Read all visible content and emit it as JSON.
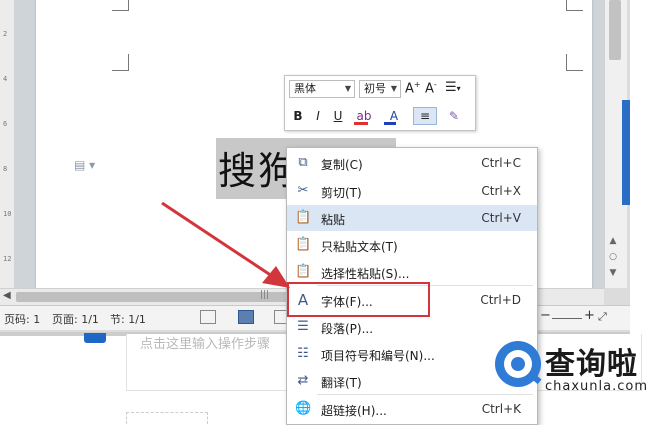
{
  "document": {
    "selected_text": "搜狗",
    "ruler_ticks": [
      "2",
      "4",
      "6",
      "8",
      "10",
      "12"
    ]
  },
  "mini_toolbar": {
    "font_name": "黑体",
    "font_size": "初号",
    "bold": "B",
    "italic": "I",
    "underline": "U"
  },
  "context_menu": {
    "items": [
      {
        "label": "复制(C)",
        "shortcut": "Ctrl+C",
        "icon": "copy-icon"
      },
      {
        "label": "剪切(T)",
        "shortcut": "Ctrl+X",
        "icon": "scissors-icon"
      },
      {
        "label": "粘贴",
        "shortcut": "Ctrl+V",
        "icon": "paste-icon"
      },
      {
        "label": "只粘贴文本(T)",
        "shortcut": "",
        "icon": "paste-text-icon"
      },
      {
        "label": "选择性粘贴(S)...",
        "shortcut": "",
        "icon": "paste-special-icon"
      },
      {
        "label": "字体(F)...",
        "shortcut": "Ctrl+D",
        "icon": "font-icon"
      },
      {
        "label": "段落(P)...",
        "shortcut": "",
        "icon": "paragraph-icon"
      },
      {
        "label": "项目符号和编号(N)...",
        "shortcut": "",
        "icon": "bullets-icon"
      },
      {
        "label": "翻译(T)",
        "shortcut": "",
        "icon": "translate-icon"
      },
      {
        "label": "超链接(H)...",
        "shortcut": "Ctrl+K",
        "icon": "hyperlink-icon"
      }
    ]
  },
  "statusbar": {
    "page_code": "页码: 1",
    "page": "页面: 1/1",
    "section": "节: 1/1"
  },
  "below": {
    "placeholder": "点击这里输入操作步骤"
  },
  "watermark": {
    "title": "查询啦",
    "url": "chaxunla.com"
  },
  "colors": {
    "accent_blue": "#2b6cc4",
    "highlight_red": "#d2363c",
    "menu_hover": "#dbe6f4"
  }
}
